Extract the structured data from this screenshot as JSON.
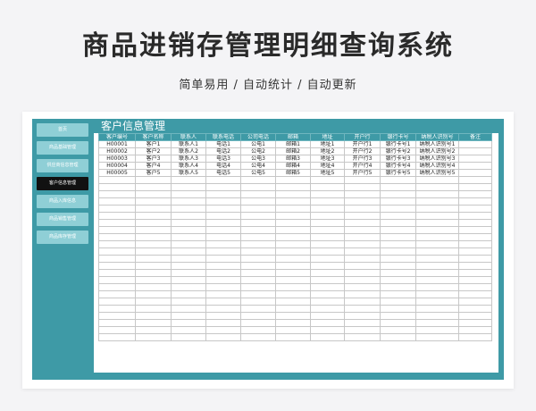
{
  "page": {
    "title": "商品进销存管理明细查询系统",
    "subtitle": "简单易用 / 自动统计 / 自动更新"
  },
  "sidebar": {
    "items": [
      {
        "label": "首页",
        "active": false
      },
      {
        "label": "商品基础管理",
        "active": false
      },
      {
        "label": "供应商信息管理",
        "active": false
      },
      {
        "label": "客户信息管理",
        "active": true
      },
      {
        "label": "商品入库信息",
        "active": false
      },
      {
        "label": "商品销售管理",
        "active": false
      },
      {
        "label": "商品库存管理",
        "active": false
      }
    ]
  },
  "panel": {
    "title": "客户信息管理"
  },
  "table": {
    "columns": [
      "客户编号",
      "客户名称",
      "联系人",
      "联系电话",
      "公司电话",
      "邮箱",
      "地址",
      "开户行",
      "银行卡号",
      "纳税人识别号",
      "备注"
    ],
    "rows": [
      [
        "H00001",
        "客户1",
        "联系人1",
        "电话1",
        "公电1",
        "邮箱1",
        "地址1",
        "开户行1",
        "银行卡号1",
        "纳税人识别号1",
        ""
      ],
      [
        "H00002",
        "客户2",
        "联系人2",
        "电话2",
        "公电2",
        "邮箱2",
        "地址2",
        "开户行2",
        "银行卡号2",
        "纳税人识别号2",
        ""
      ],
      [
        "H00003",
        "客户3",
        "联系人3",
        "电话3",
        "公电3",
        "邮箱3",
        "地址3",
        "开户行3",
        "银行卡号3",
        "纳税人识别号3",
        ""
      ],
      [
        "H00004",
        "客户4",
        "联系人4",
        "电话4",
        "公电4",
        "邮箱4",
        "地址4",
        "开户行4",
        "银行卡号4",
        "纳税人识别号4",
        ""
      ],
      [
        "H00005",
        "客户5",
        "联系人5",
        "电话5",
        "公电5",
        "邮箱5",
        "地址5",
        "开户行5",
        "银行卡号5",
        "纳税人识别号5",
        ""
      ]
    ]
  },
  "colors": {
    "accent": "#3e9aa6",
    "nav_button": "#8fcfd6",
    "nav_active": "#111111"
  }
}
